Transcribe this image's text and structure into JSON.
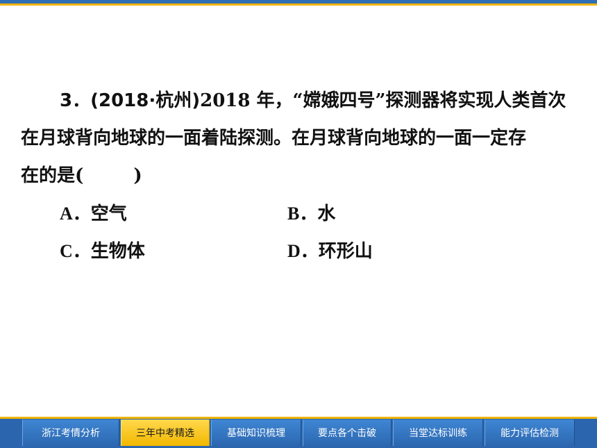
{
  "question": {
    "number": "3．",
    "source": "(2018·杭州)",
    "line1_text": "2018 年，“嫦娥四号”探测器将实现人类首次",
    "line2_text": "在月球背向地球的一面着陆探测。在月球背向地球的一面一定存",
    "line3_prefix": "在的是(",
    "line3_suffix": ")"
  },
  "options": [
    {
      "letter": "A．",
      "text": "空气"
    },
    {
      "letter": "B．",
      "text": "水"
    },
    {
      "letter": "C．",
      "text": "生物体"
    },
    {
      "letter": "D．",
      "text": "环形山"
    }
  ],
  "nav": {
    "tabs": [
      {
        "label": "浙江考情分析",
        "active": false
      },
      {
        "label": "三年中考精选",
        "active": true
      },
      {
        "label": "基础知识梳理",
        "active": false
      },
      {
        "label": "要点各个击破",
        "active": false
      },
      {
        "label": "当堂达标训练",
        "active": false
      },
      {
        "label": "能力评估检测",
        "active": false
      }
    ]
  },
  "colors": {
    "accent_blue": "#2a65ad",
    "accent_gold": "#f0b400"
  }
}
